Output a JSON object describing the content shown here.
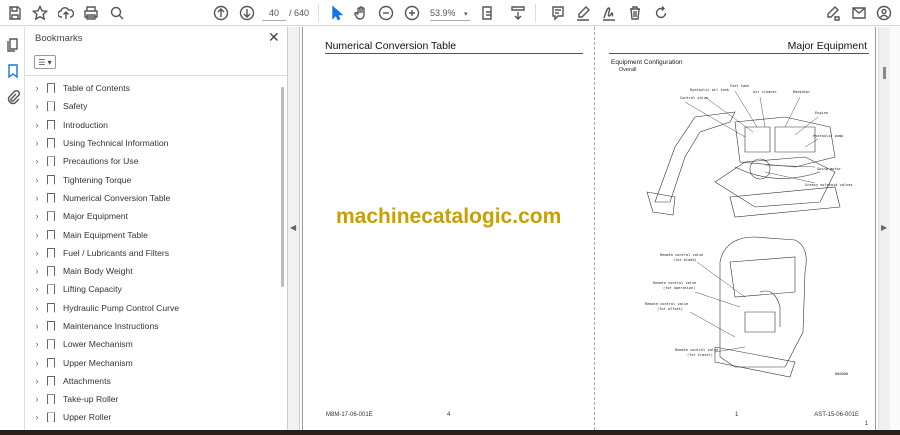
{
  "toolbar": {
    "page_current": "40",
    "page_total": "/ 640",
    "zoom": "53.9%",
    "icons": [
      "save-icon",
      "bookmark-star-icon",
      "upload-icon",
      "print-icon",
      "find-icon",
      "page-up-icon",
      "page-down-icon",
      "select-cursor-icon",
      "hand-icon",
      "zoom-out-icon",
      "zoom-in-icon",
      "fit-page-icon",
      "scroll-mode-icon",
      "comment-icon",
      "highlight-icon",
      "sign-icon",
      "delete-icon",
      "rotate-icon",
      "fill-sign-icon",
      "email-icon",
      "account-icon"
    ]
  },
  "left_strip": {
    "icons": [
      "pages-icon",
      "bookmarks-icon",
      "attachments-icon"
    ]
  },
  "bookmarks": {
    "title": "Bookmarks",
    "items": [
      "Table of Contents",
      "Safety",
      "Introduction",
      "Using Technical Information",
      "Precautions for Use",
      "Tightening Torque",
      "Numerical Conversion Table",
      "Major Equipment",
      "Main Equipment Table",
      "Fuel / Lubricants and Filters",
      "Main Body Weight",
      "Lifting Capacity",
      "Hydraulic Pump Control Curve",
      "Maintenance Instructions",
      "Lower Mechanism",
      "Upper Mechanism",
      "Attachments",
      "Take-up Roller",
      "Upper Roller"
    ]
  },
  "document": {
    "left_page": {
      "title": "Numerical Conversion Table",
      "footer_code": "M8M-17-06-001E",
      "footer_page": "4"
    },
    "right_page": {
      "title": "Major Equipment",
      "section": "Equipment Configuration",
      "subsection": "Overall",
      "labels_top": [
        "Hydraulic oil tank",
        "Fuel tank",
        "Air cleaner",
        "Radiator",
        "Control valve",
        "Engine",
        "Hydraulic pump",
        "Swing motor",
        "Greasy solenoid valves"
      ],
      "labels_bottom": [
        "Remote control valve",
        "(for blade)",
        "Remote control valve",
        "(for operation)",
        "Remote control valve",
        "(for offset)",
        "Remote control valve",
        "(for travel)"
      ],
      "figure_code": "000000",
      "footer_page": "1",
      "footer_code": "AST-15-06-001E",
      "corner_mark": "1"
    },
    "watermark": "machinecatalogic.com"
  }
}
